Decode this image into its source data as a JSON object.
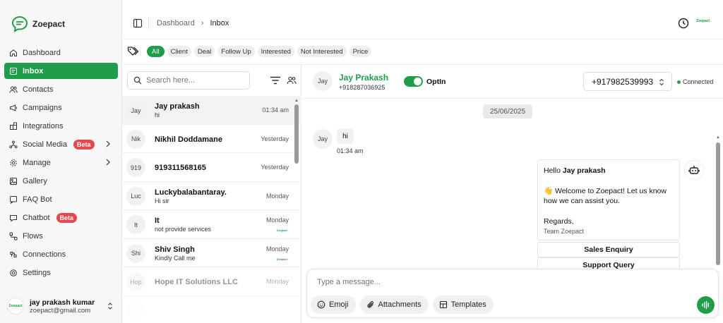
{
  "brand": {
    "name": "Zoepact",
    "mini": "Zoepact",
    "accent": "#1f9d4b"
  },
  "sidebar": {
    "items": [
      {
        "label": "Dashboard",
        "icon": "home-icon"
      },
      {
        "label": "Inbox",
        "icon": "inbox-icon",
        "active": true
      },
      {
        "label": "Contacts",
        "icon": "users-icon"
      },
      {
        "label": "Campaigns",
        "icon": "megaphone-icon"
      },
      {
        "label": "Integrations",
        "icon": "puzzle-icon"
      },
      {
        "label": "Social Media",
        "icon": "share-icon",
        "badge": "Beta",
        "chevron": true
      },
      {
        "label": "Manage",
        "icon": "gear-icon",
        "chevron": true
      },
      {
        "label": "Gallery",
        "icon": "image-icon"
      },
      {
        "label": "FAQ Bot",
        "icon": "help-icon"
      },
      {
        "label": "Chatbot",
        "icon": "chat-icon",
        "badge": "Beta"
      },
      {
        "label": "Flows",
        "icon": "flow-icon"
      },
      {
        "label": "Connections",
        "icon": "link-icon"
      },
      {
        "label": "Settings",
        "icon": "settings-icon"
      }
    ],
    "user": {
      "name": "jay prakash kumar",
      "email": "zoepact@gmail.com",
      "avatar": "Zoepact"
    }
  },
  "header": {
    "breadcrumb": [
      "Dashboard",
      "Inbox"
    ]
  },
  "tags": [
    "All",
    "Client",
    "Deal",
    "Follow Up",
    "Interested",
    "Not Interested",
    "Price"
  ],
  "search": {
    "placeholder": "Search here..."
  },
  "conversations": [
    {
      "initials": "Jay",
      "name": "Jay prakash",
      "message": "hi",
      "time": "01:34 am",
      "selected": true
    },
    {
      "initials": "Nik",
      "name": "Nikhil Doddamane",
      "message": "",
      "time": "Yesterday"
    },
    {
      "initials": "919",
      "name": "919311568165",
      "message": "",
      "time": "Yesterday"
    },
    {
      "initials": "Luc",
      "name": "Luckybalabantaray.",
      "message": "Hi sir",
      "time": "Monday"
    },
    {
      "initials": "It",
      "name": "It",
      "message": "not provide services",
      "time": "Monday",
      "mini": "Zoepact"
    },
    {
      "initials": "Shi",
      "name": "Shiv Singh",
      "message": "Kindly Call me",
      "time": "Monday",
      "mini": "Zoepact"
    },
    {
      "initials": "Hop",
      "name": "Hope IT Solutions LLC",
      "message": "",
      "time": "Monday",
      "faded": true
    }
  ],
  "chat": {
    "contact": {
      "initials": "Jay",
      "name": "Jay Prakash",
      "phone": "+918287036925"
    },
    "optin_label": "OptIn",
    "number": "+917982539993",
    "status": "Connected",
    "date": "25/06/2025",
    "incoming": {
      "initials": "Jay",
      "text": "hi",
      "time": "01:34 am"
    },
    "outgoing": {
      "greeting_prefix": "Hello ",
      "greeting_name": "Jay prakash",
      "welcome": "👋 Welcome to Zoepact! Let us know how we can assist you.",
      "regards": "Regards,",
      "signature": "Team Zoepact"
    },
    "quick_replies": [
      "Sales Enquiry",
      "Support Query"
    ]
  },
  "composer": {
    "placeholder": "Type a message...",
    "buttons": [
      {
        "label": "Emoji",
        "icon": "smile-icon"
      },
      {
        "label": "Attachments",
        "icon": "paperclip-icon"
      },
      {
        "label": "Templates",
        "icon": "template-icon"
      }
    ]
  }
}
